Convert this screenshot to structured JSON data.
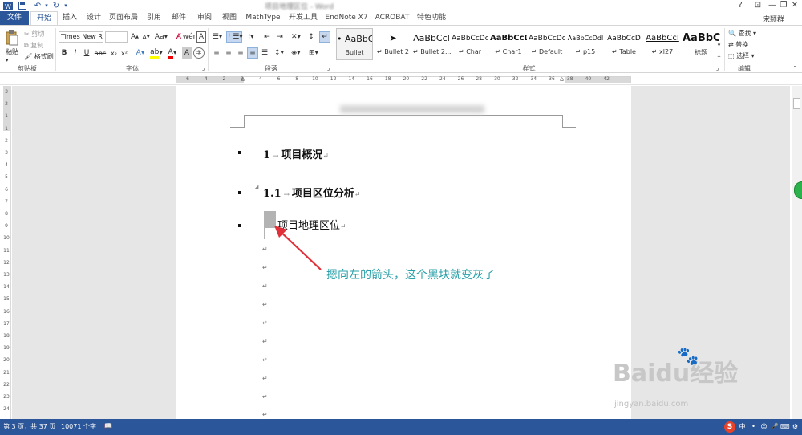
{
  "titlebar": {
    "doc_title": "项目地理区位 - Word",
    "quick_access": [
      "word-logo-icon",
      "save-icon",
      "undo-icon",
      "redo-icon"
    ],
    "window_controls": [
      "?",
      "⊡",
      "—",
      "❐",
      "✕"
    ],
    "user": "宋颖群"
  },
  "tabs": [
    "文件",
    "开始",
    "插入",
    "设计",
    "页面布局",
    "引用",
    "邮件",
    "审阅",
    "视图",
    "MathType",
    "开发工具",
    "EndNote X7",
    "ACROBAT",
    "特色功能"
  ],
  "ribbon": {
    "clipboard": {
      "paste": "粘贴",
      "cut": "剪切",
      "copy": "复制",
      "format_painter": "格式刷",
      "group": "剪贴板"
    },
    "font": {
      "font_name": "Times New R",
      "font_size": "",
      "bold": "B",
      "italic": "I",
      "underline": "U",
      "strike": "abc",
      "sub": "x₂",
      "sup": "x²",
      "group": "字体"
    },
    "paragraph": {
      "group": "段落"
    },
    "styles": {
      "group": "样式",
      "items": [
        {
          "sample": "• AaBbC",
          "name": "Bullet"
        },
        {
          "sample": "➤",
          "name": "↵ Bullet 2"
        },
        {
          "sample": "AaBbCcI",
          "name": "↵ Bullet 2..."
        },
        {
          "sample": "AaBbCcDc",
          "name": "↵ Char"
        },
        {
          "sample": "AaBbCcD",
          "name": "↵ Char1"
        },
        {
          "sample": "AaBbCcDc",
          "name": "↵ Default"
        },
        {
          "sample": "AaBbCcDdI",
          "name": "↵ p15"
        },
        {
          "sample": "AaBbCcD",
          "name": "↵ Table"
        },
        {
          "sample": "AaBbCcI",
          "name": "↵ xl27"
        },
        {
          "sample": "AaBbC",
          "name": "标题"
        }
      ]
    },
    "editing": {
      "find": "查找",
      "replace": "替换",
      "select": "选择",
      "group": "编辑"
    }
  },
  "ruler": {
    "numbers": [
      "6",
      "4",
      "2",
      "2",
      "4",
      "6",
      "8",
      "10",
      "12",
      "14",
      "16",
      "18",
      "20",
      "22",
      "24",
      "26",
      "28",
      "30",
      "32",
      "34",
      "36",
      "38",
      "40",
      "42"
    ]
  },
  "vruler": {
    "numbers": [
      "3",
      "2",
      "1",
      "1",
      "2",
      "3",
      "4",
      "5",
      "6",
      "7",
      "8",
      "9",
      "10",
      "11",
      "12",
      "13",
      "14",
      "15",
      "16",
      "17",
      "18",
      "19",
      "20",
      "21",
      "22",
      "23",
      "24"
    ]
  },
  "document": {
    "heading1": {
      "num": "1",
      "text": "项目概况"
    },
    "heading2": {
      "num": "1.1",
      "text": "项目区位分析"
    },
    "heading3": {
      "text": "项目地理区位"
    },
    "para_mark": "↵",
    "annotation": "摁向左的箭头，这个黑块就变灰了"
  },
  "watermark": {
    "text": "Baidu经验",
    "url": "jingyan.baidu.com"
  },
  "status": {
    "page": "第 3 页，共 37 页",
    "words": "10071 个字"
  },
  "colors": {
    "accent": "#2b579a",
    "annotation": "#2aa0a8",
    "arrow": "#e0303a"
  }
}
